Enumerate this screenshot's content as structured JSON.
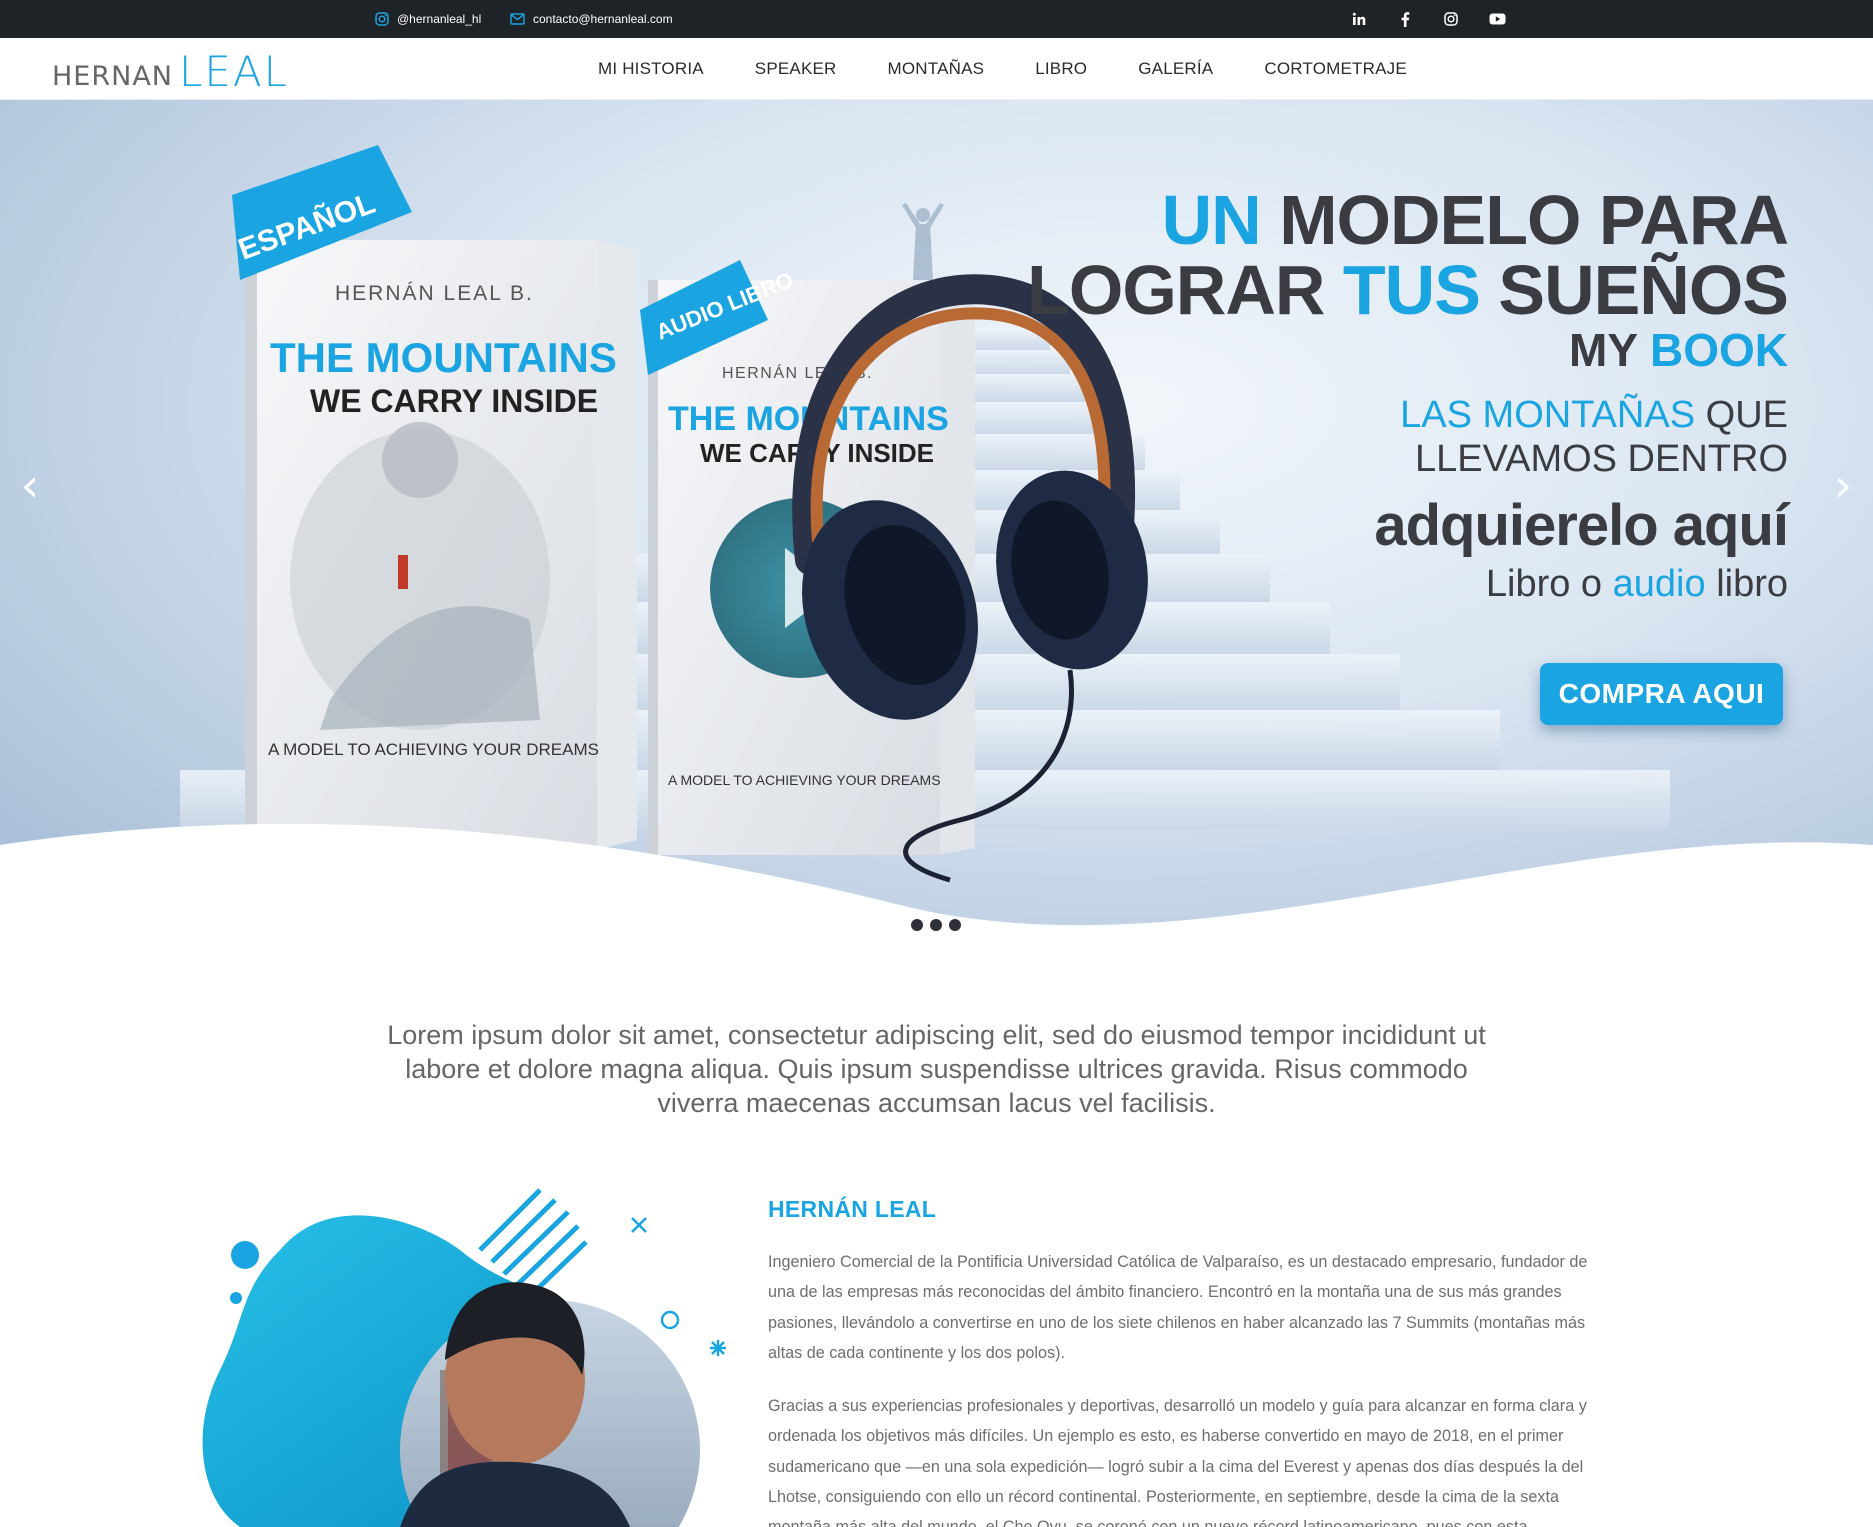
{
  "topbar": {
    "instagram_handle": "@hernanleal_hl",
    "email": "contacto@hernanleal.com",
    "social_icons": [
      "linkedin-icon",
      "facebook-icon",
      "instagram-icon",
      "youtube-icon"
    ]
  },
  "header": {
    "logo_first": "HERNAN",
    "logo_last": "LEAL",
    "nav": [
      "MI HISTORIA",
      "SPEAKER",
      "MONTAÑAS",
      "LIBRO",
      "GALERÍA",
      "CORTOMETRAJE"
    ]
  },
  "hero": {
    "line1_blue": "UN",
    "line1_rest": "MODELO PARA",
    "line2_a": "LOGRAR",
    "line2_blue": "TUS",
    "line2_b": "SUEÑOS",
    "line3_a": "MY",
    "line3_blue": "BOOK",
    "line4_blue": "LAS MONTAÑAS",
    "line4_rest": "QUE",
    "line5": "LLEVAMOS DENTRO",
    "line6": "adquierelo aquí",
    "line7_a": "Libro o",
    "line7_blue": "audio",
    "line7_b": "libro",
    "cta": "COMPRA AQUI",
    "prev_arrow": "‹",
    "next_arrow": "›",
    "slides": 3,
    "book_ribbon_1": "ESPAÑOL",
    "book_ribbon_2": "AUDIO LIBRO",
    "book_author": "HERNÁN LEAL B.",
    "book_title_1": "THE MOUNTAINS",
    "book_title_2": "WE CARRY INSIDE",
    "book_subtitle": "A MODEL TO ACHIEVING YOUR DREAMS"
  },
  "intro": "Lorem ipsum dolor sit amet, consectetur adipiscing elit, sed do eiusmod tempor incididunt ut labore et dolore magna aliqua. Quis ipsum suspendisse ultrices gravida. Risus commodo viverra maecenas accumsan lacus vel facilisis.",
  "about": {
    "title": "HERNÁN LEAL",
    "p1": "Ingeniero Comercial de la Pontificia Universidad Católica de Valparaíso, es un destacado empresario, fundador de una de las empresas más reconocidas del ámbito financiero. Encontró en la montaña una de sus más grandes pasiones, llevándolo a convertirse en uno de los siete chilenos en haber alcanzado las 7 Summits (montañas más altas de cada continente y los dos polos).",
    "p2": "Gracias a sus experiencias profesionales y deportivas, desarrolló un modelo y guía para alcanzar en forma clara y ordenada los objetivos más difíciles. Un ejemplo es esto, es haberse convertido en mayo de 2018, en el primer sudamericano que —en una sola expedición— logró subir a la cima del Everest y apenas dos días después la del Lhotse, consiguiendo con ello un récord continental. Posteriormente, en septiembre, desde la cima de la sexta montaña más alta del mundo, el Cho Oyu, se coronó con un nuevo récord latinoamericano, pues con esta"
  },
  "colors": {
    "accent": "#1aa4e2",
    "dark": "#1e2327",
    "text": "#3a3c41"
  }
}
